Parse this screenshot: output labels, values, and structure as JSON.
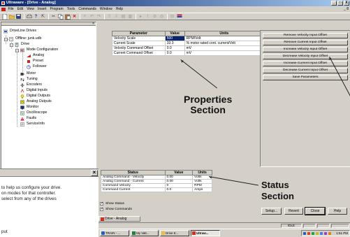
{
  "window": {
    "title": "Ultraware - [Drive - Analog]",
    "controls": [
      "_",
      "□",
      "X"
    ],
    "child_controls": [
      "_",
      "8"
    ]
  },
  "menu": [
    "File",
    "Edit",
    "View",
    "Insert",
    "Program",
    "Tools",
    "Commands",
    "Window",
    "Help"
  ],
  "toolbar_icons": [
    "new-icon",
    "open-icon",
    "save-icon",
    "print-icon",
    "help-icon",
    "pointer-help-icon",
    "cut-icon",
    "copy-icon",
    "paste-icon",
    "delete-icon",
    "find-icon",
    "undo-icon",
    "redo-icon",
    "upload-icon",
    "download-icon",
    "compile-icon",
    "step-icon",
    "run-icon",
    "stop-icon",
    "reset-icon",
    "monitor-icon",
    "flag-icon"
  ],
  "tree": {
    "root": "DriveLine Drives",
    "file": "Offline: junk.udb",
    "drive": "Drive",
    "mode_config": "Mode Configuration",
    "mode_children": [
      "Analog",
      "Preset",
      "Follower"
    ],
    "items": [
      "Motor",
      "Tuning",
      "Encoders",
      "Digital Inputs",
      "Digital Outputs",
      "Analog Outputs",
      "Monitor",
      "Oscilloscope",
      "Faults",
      "ServiceInfo"
    ]
  },
  "params": {
    "headers": [
      "Parameter",
      "Value",
      "Units"
    ],
    "rows": [
      {
        "name": "Velocity Scale",
        "value": "500",
        "units": "RPM/Volt"
      },
      {
        "name": "Current Scale",
        "value": "33.3",
        "units": "% motor rated cont. current/Volt"
      },
      {
        "name": "Velocity Command Offset",
        "value": "0.0",
        "units": "mV"
      },
      {
        "name": "Current Command Offset",
        "value": "0.0",
        "units": "mV"
      }
    ]
  },
  "commands": [
    "Remove Velocity Input Offset",
    "Remove Current Input Offset",
    "Increase Velocity Input Offset",
    "Decrease Velocity Input Offset",
    "Increase Current Input Offset",
    "Decrease Current Input Offset",
    "Save Parameters"
  ],
  "status": {
    "headers": [
      "Status",
      "Value",
      "Units"
    ],
    "rows": [
      {
        "name": "Analog Command - Velocity",
        "value": "0.00",
        "units": "Volts"
      },
      {
        "name": "Analog Command - Current",
        "value": "0.00",
        "units": "Volts"
      },
      {
        "name": "Command Velocity",
        "value": "0",
        "units": "RPM"
      },
      {
        "name": "Command Current",
        "value": "0.0",
        "units": "Amps"
      }
    ]
  },
  "annotations": {
    "properties_line1": "Properties",
    "properties_line2": "Section",
    "status_line1": "Status",
    "status_line2": "Section"
  },
  "checkboxes": [
    {
      "label": "Show Status",
      "checked": true
    },
    {
      "label": "Show Commands",
      "checked": true
    }
  ],
  "bottom_buttons": [
    "Setup...",
    "Revert",
    "Close",
    "Help"
  ],
  "doc_tab": "Drive - Analog",
  "statusbar": {
    "mode": "IDLE"
  },
  "taskbar": {
    "tasks": [
      "TRAIN - ...",
      "My Vab...",
      "Drive E...",
      "Ultraw..."
    ],
    "clock": "1:51 PM"
  },
  "dialog": {
    "lines": [
      "to help us configure your drive.",
      "on modes for that controller.",
      "select from any of the drives",
      "put"
    ]
  },
  "colors": {
    "selection": "#0a246a",
    "titlebar": "#0a246a",
    "face": "#d4d0c8"
  }
}
